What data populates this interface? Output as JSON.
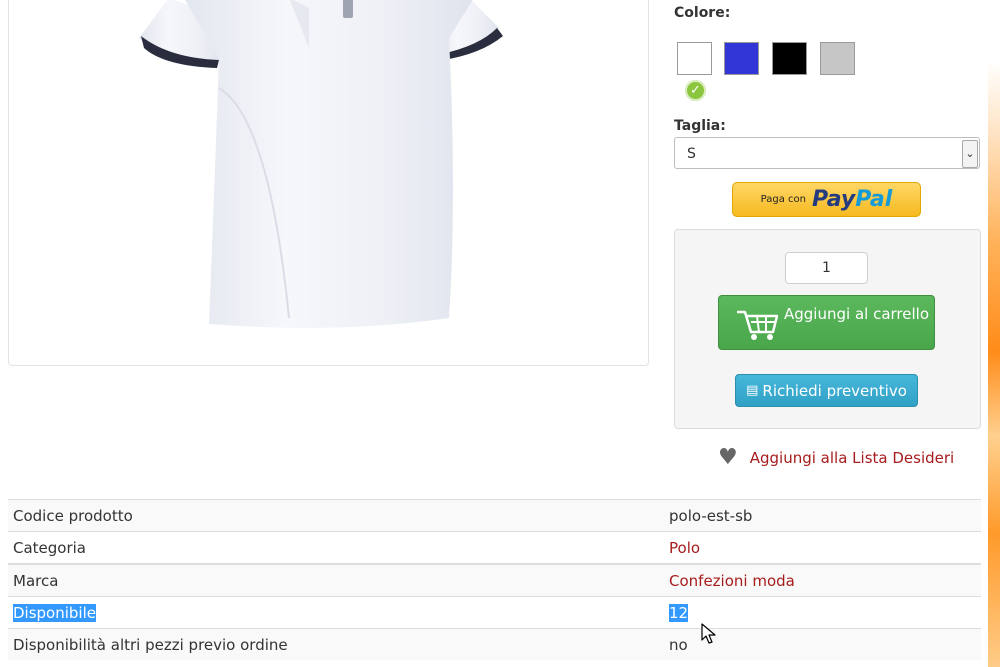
{
  "product": {
    "color_label": "Colore:",
    "colors": [
      "#ffffff",
      "#3336d6",
      "#000000",
      "#c6c6c6"
    ],
    "selected_color_index": 0,
    "size_label": "Taglia:",
    "size_value": "S"
  },
  "paypal": {
    "prefix": "Paga con",
    "logo_pay": "Pay",
    "logo_pal": "Pal"
  },
  "cart": {
    "quantity": "1",
    "add_to_cart": "Aggiungi al carrello",
    "request_quote": "Richiedi preventivo"
  },
  "wishlist": {
    "label": "Aggiungi alla Lista Desideri"
  },
  "specs": [
    {
      "label": "Codice prodotto",
      "value": "polo-est-sb"
    },
    {
      "label": "Categoria",
      "value": "Polo"
    },
    {
      "label": "Marca",
      "value": "Confezioni moda"
    },
    {
      "label": "Disponibile",
      "value": "12"
    },
    {
      "label": "Disponibilità altri pezzi previo ordine",
      "value": "no"
    }
  ],
  "theme": {
    "link_color": "#a61c1c",
    "success_color": "#5cb85c",
    "info_color": "#46b8da",
    "selection_color": "#3399ff"
  }
}
